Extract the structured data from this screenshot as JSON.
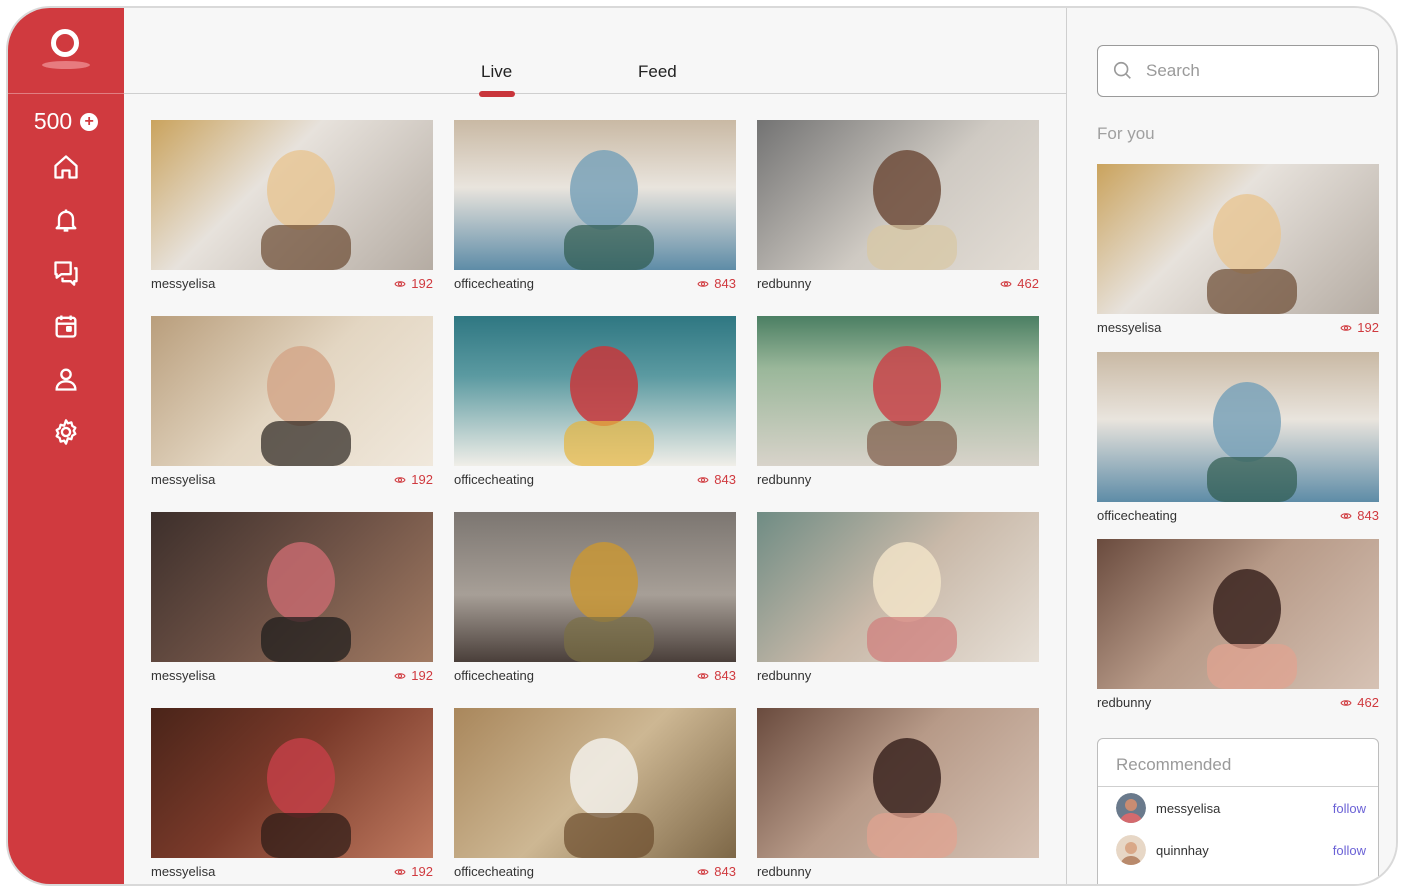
{
  "sidebar": {
    "credits": "500",
    "credits_add": "+",
    "nav": [
      {
        "icon": "home-icon"
      },
      {
        "icon": "bell-icon"
      },
      {
        "icon": "chat-icon"
      },
      {
        "icon": "calendar-icon"
      },
      {
        "icon": "profile-icon"
      },
      {
        "icon": "gear-icon"
      }
    ]
  },
  "tabs": {
    "live": "Live",
    "feed": "Feed",
    "active": "Live"
  },
  "grid": [
    {
      "user": "messyelisa",
      "views": "192"
    },
    {
      "user": "officecheating",
      "views": "843"
    },
    {
      "user": "redbunny",
      "views": "462"
    },
    {
      "user": "messyelisa",
      "views": "192"
    },
    {
      "user": "officecheating",
      "views": "843"
    },
    {
      "user": "redbunny",
      "views": ""
    },
    {
      "user": "messyelisa",
      "views": "192"
    },
    {
      "user": "officecheating",
      "views": "843"
    },
    {
      "user": "redbunny",
      "views": ""
    },
    {
      "user": "messyelisa",
      "views": "192"
    },
    {
      "user": "officecheating",
      "views": "843"
    },
    {
      "user": "redbunny",
      "views": ""
    }
  ],
  "right": {
    "search_placeholder": "Search",
    "for_you_title": "For you",
    "for_you": [
      {
        "user": "messyelisa",
        "views": "192"
      },
      {
        "user": "officecheating",
        "views": "843"
      },
      {
        "user": "redbunny",
        "views": "462"
      }
    ],
    "recommended_title": "Recommended",
    "recommended": [
      {
        "user": "messyelisa",
        "action": "follow"
      },
      {
        "user": "quinnhay",
        "action": "follow"
      }
    ]
  },
  "colors": {
    "brand": "#d03a3f",
    "link": "#6b62d6"
  }
}
